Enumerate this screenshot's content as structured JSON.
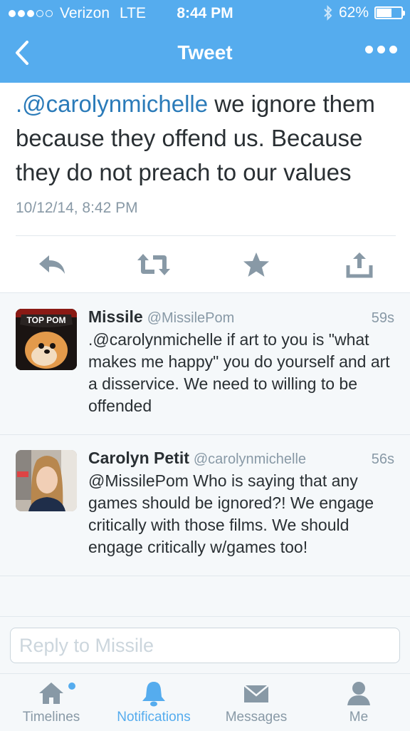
{
  "status_bar": {
    "carrier": "Verizon",
    "network": "LTE",
    "time": "8:44 PM",
    "battery": "62%",
    "battery_level": 0.62,
    "signal_bars_filled": 3,
    "signal_bars_total": 5
  },
  "nav": {
    "title": "Tweet",
    "back_icon": "chevron-left-icon",
    "more_icon": "more-dots-icon"
  },
  "main_tweet": {
    "mention": ".@carolynmichelle",
    "text": " we ignore them because they offend us. Because they do not preach to our values",
    "timestamp": "10/12/14, 8:42 PM",
    "actions": [
      "reply-icon",
      "retweet-icon",
      "favorite-icon",
      "share-icon"
    ]
  },
  "replies": [
    {
      "name": "Missile",
      "handle": "@MissilePom",
      "age": "59s",
      "text": ".@carolynmichelle if art to you is \"what makes me happy\" you do yourself and art a disservice. We need to willing to be offended",
      "avatar_label": "TOP POM"
    },
    {
      "name": "Carolyn Petit",
      "handle": "@carolynmichelle",
      "age": "56s",
      "text": "@MissilePom Who is saying that any games should be ignored?! We engage critically with those films. We should engage critically w/games too!"
    }
  ],
  "reply_box": {
    "placeholder": "Reply to Missile"
  },
  "tabs": [
    {
      "label": "Timelines",
      "icon": "home-icon",
      "active": false
    },
    {
      "label": "Notifications",
      "icon": "bell-icon",
      "active": true
    },
    {
      "label": "Messages",
      "icon": "envelope-icon",
      "active": false
    },
    {
      "label": "Me",
      "icon": "person-icon",
      "active": false
    }
  ],
  "colors": {
    "brand": "#55acee",
    "link": "#2b7bb9",
    "muted": "#8899a6",
    "text": "#292f33"
  }
}
